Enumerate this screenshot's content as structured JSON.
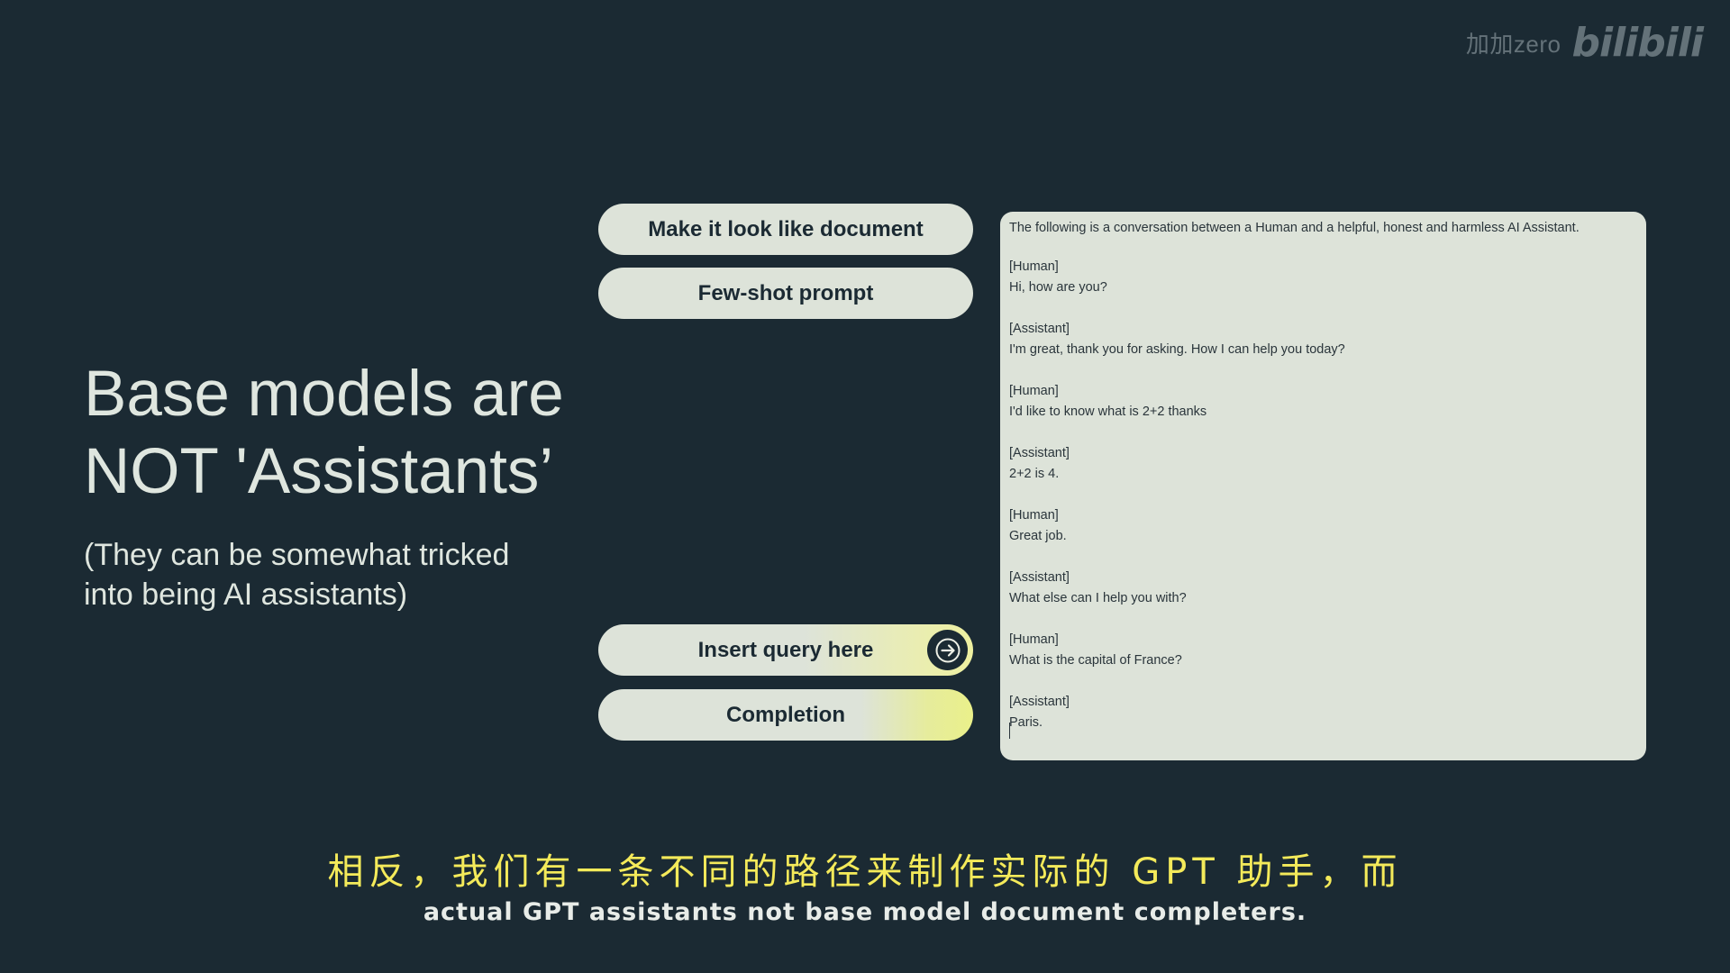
{
  "watermark": {
    "user": "加加zero",
    "logo": "bilibili"
  },
  "slide": {
    "title_line1": "Base models are",
    "title_line2": "NOT 'Assistants’",
    "subtitle_line1": "(They can be somewhat tricked",
    "subtitle_line2": "into being AI assistants)"
  },
  "buttons": {
    "document": "Make it look like document",
    "fewshot": "Few-shot prompt",
    "query": "Insert query here",
    "completion": "Completion"
  },
  "document": {
    "intro": "The following is a conversation between a Human and a helpful, honest and harmless AI Assistant.",
    "turns": [
      {
        "role": "[Human]",
        "text": "Hi, how are you?"
      },
      {
        "role": "[Assistant]",
        "text": "I'm great, thank you for asking. How I can help you today?"
      },
      {
        "role": "[Human]",
        "text": "I'd like to know what is 2+2 thanks"
      },
      {
        "role": "[Assistant]",
        "text": "2+2 is 4."
      },
      {
        "role": "[Human]",
        "text": "Great job."
      },
      {
        "role": "[Assistant]",
        "text": "What else can I help you with?"
      },
      {
        "role": "[Human]",
        "text": "What is the capital of France?"
      },
      {
        "role": "[Assistant]",
        "text": "Paris."
      }
    ]
  },
  "captions": {
    "chinese": "相反，我们有一条不同的路径来制作实际的 GPT 助手，而",
    "english": "actual GPT assistants not base model document completers."
  },
  "colors": {
    "background": "#1b2a33",
    "pill": "#dde3d9",
    "highlight": "#eef0a0",
    "caption_cn": "#f4ea5a"
  }
}
